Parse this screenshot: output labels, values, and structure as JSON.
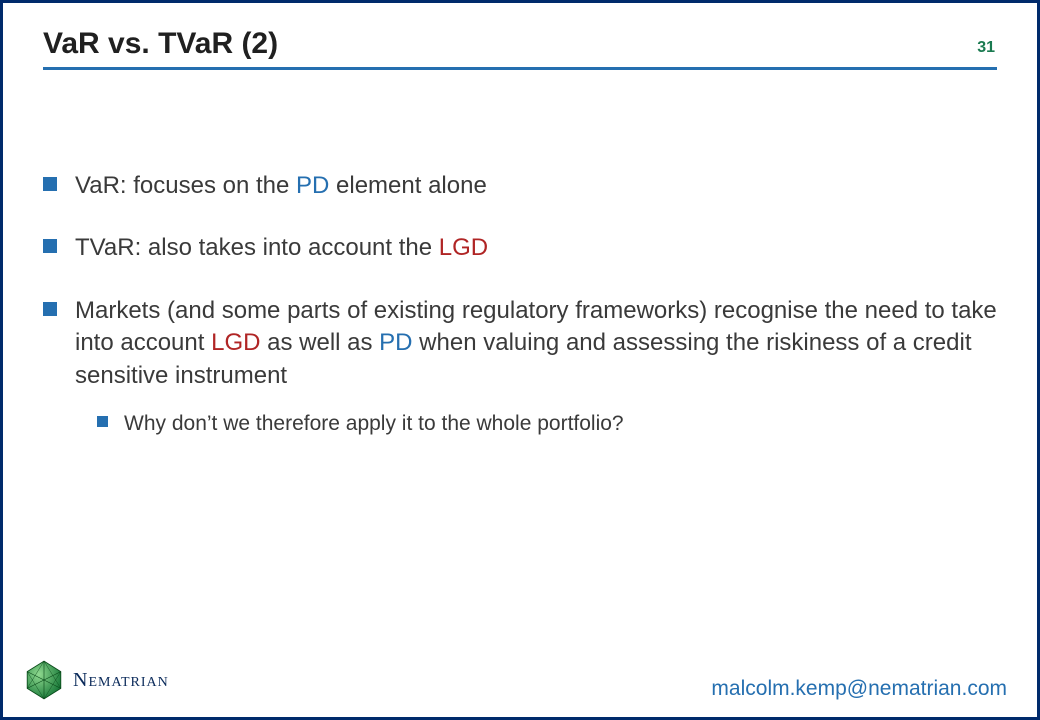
{
  "header": {
    "title": "VaR vs. TVaR (2)",
    "page_number": "31"
  },
  "bullets": [
    {
      "segments": [
        {
          "text": "VaR: focuses on the "
        },
        {
          "text": "PD",
          "class": "pd"
        },
        {
          "text": " element alone"
        }
      ]
    },
    {
      "segments": [
        {
          "text": "TVaR: also takes into account the "
        },
        {
          "text": "LGD",
          "class": "lgd"
        }
      ]
    },
    {
      "segments": [
        {
          "text": "Markets (and some parts of existing regulatory frameworks) recognise the need to take into account "
        },
        {
          "text": "LGD",
          "class": "lgd"
        },
        {
          "text": " as well as "
        },
        {
          "text": "PD",
          "class": "pd"
        },
        {
          "text": " when valuing and assessing the riskiness of a credit sensitive instrument"
        }
      ],
      "sub": {
        "segments": [
          {
            "text": "Why don’t we therefore apply it to the whole portfolio?"
          }
        ]
      }
    }
  ],
  "footer": {
    "brand": "Nematrian",
    "contact": "malcolm.kemp@nematrian.com"
  }
}
